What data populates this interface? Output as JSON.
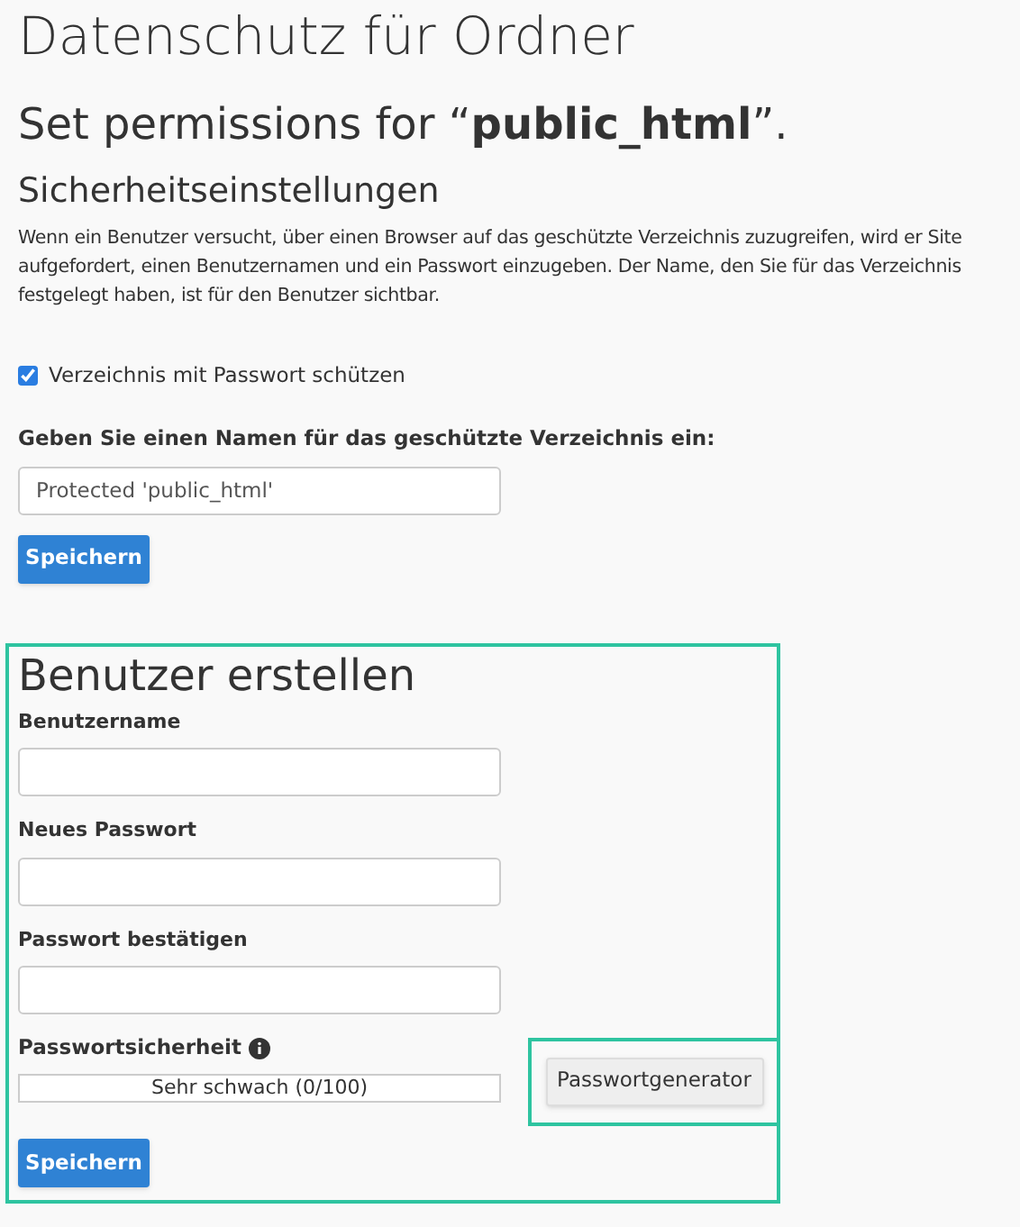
{
  "page_title": "Datenschutz für Ordner",
  "heading": "Set permissions for “**public_html**”.",
  "security": {
    "title": "Sicherheitseinstellungen",
    "description": "Wenn ein Benutzer versucht, über einen Browser auf das geschützte Verzeichnis zuzugreifen, wird er Site aufgefordert, einen Benutzernamen und ein Passwort einzugeben. Der Name, den Sie für das Verzeichnis festgelegt haben, ist für den Benutzer sichtbar.",
    "protect_checkbox": {
      "label": "Verzeichnis mit Passwort schützen",
      "checked": true
    },
    "name_field": {
      "label": "Geben Sie einen Namen für das geschützte Verzeichnis ein:",
      "value": "Protected 'public_html'"
    },
    "save_button": "Speichern"
  },
  "create_user": {
    "title": "Benutzer erstellen",
    "fields": [
      {
        "label": "Benutzername"
      },
      {
        "label": "Neues Passwort"
      },
      {
        "label": "Passwort bestätigen"
      }
    ],
    "strength": {
      "label": "Passwortsicherheit",
      "level": 0,
      "reading": "Sehr schwach (0/100)"
    },
    "generator_button": "Passwortgenerator",
    "save_button": "Speichern"
  }
}
